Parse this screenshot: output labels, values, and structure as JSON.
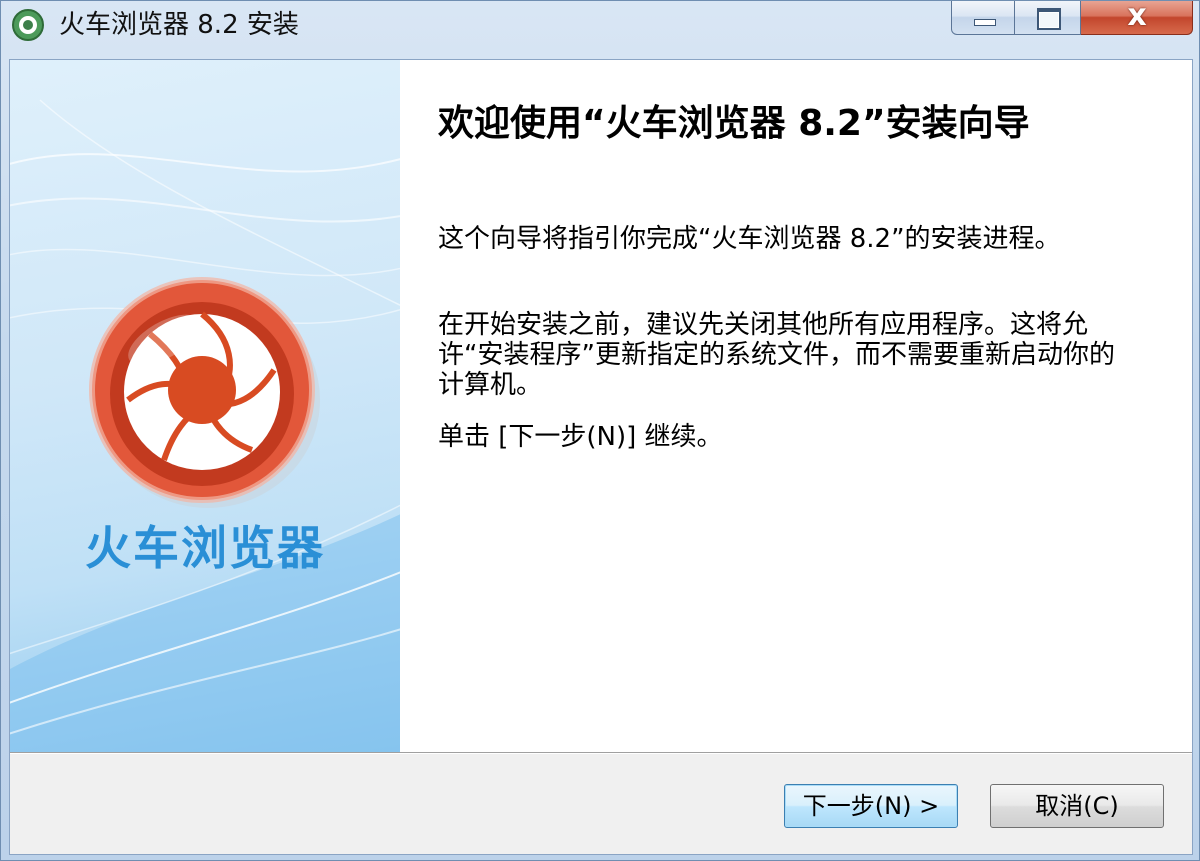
{
  "window": {
    "title": "火车浏览器 8.2 安装",
    "close_glyph": "x",
    "icons": {
      "app": "app-logo-icon",
      "minimize": "minimize-icon",
      "maximize": "maximize-icon",
      "close": "close-icon"
    }
  },
  "side_panel": {
    "brand_name": "火车浏览器",
    "logo_icon": "aperture-logo-icon",
    "colors": {
      "brand_text": "#2a8fd6",
      "logo_outer": "#e2573a",
      "logo_core": "#d84b22"
    }
  },
  "content": {
    "heading": "欢迎使用“火车浏览器 8.2”安装向导",
    "paragraphs": [
      "这个向导将指引你完成“火车浏览器 8.2”的安装进程。",
      "在开始安装之前，建议先关闭其他所有应用程序。这将允许“安装程序”更新指定的系统文件，而不需要重新启动你的计算机。",
      "单击 [下一步(N)] 继续。"
    ]
  },
  "buttons": {
    "next": "下一步(N) >",
    "cancel": "取消(C)"
  }
}
